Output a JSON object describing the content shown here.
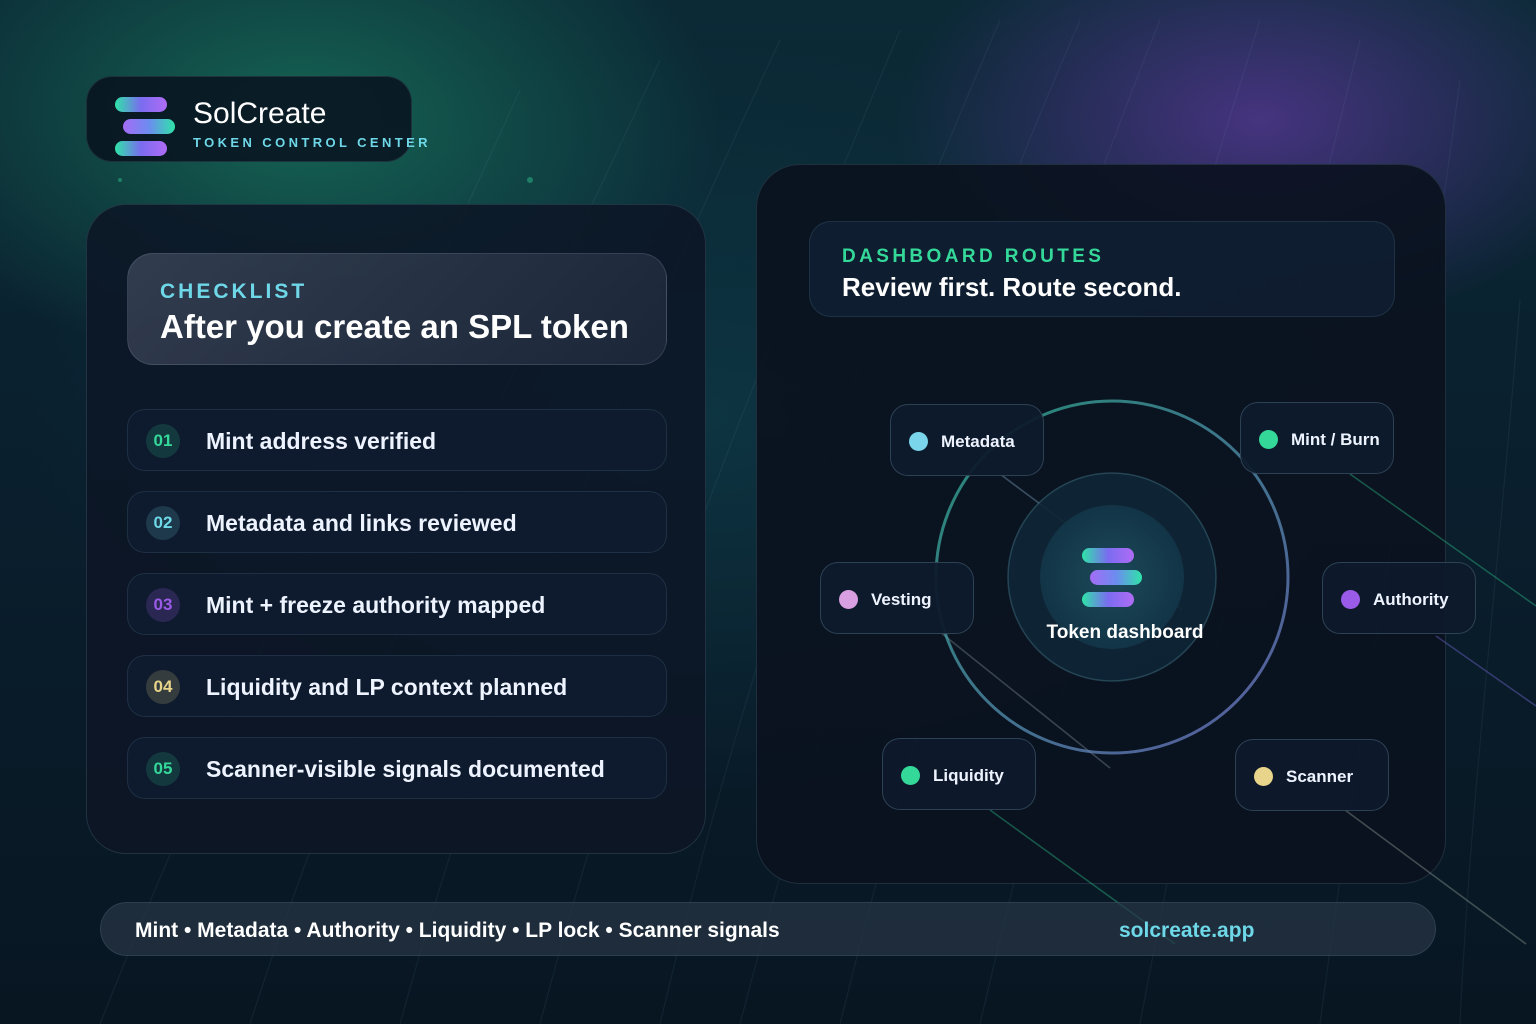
{
  "brand": {
    "name": "SolCreate",
    "subtitle": "TOKEN CONTROL CENTER",
    "icon": "stacked-bars-logo-icon"
  },
  "checklist": {
    "kicker": "CHECKLIST",
    "title": "After you create an SPL token",
    "items": [
      {
        "num": "01",
        "label": "Mint address verified",
        "color": "#34d99a"
      },
      {
        "num": "02",
        "label": "Metadata and links reviewed",
        "color": "#6ed8e8"
      },
      {
        "num": "03",
        "label": "Mint + freeze authority mapped",
        "color": "#9a5ce8"
      },
      {
        "num": "04",
        "label": "Liquidity and LP context planned",
        "color": "#e8d48a"
      },
      {
        "num": "05",
        "label": "Scanner-visible signals documented",
        "color": "#34d99a"
      }
    ]
  },
  "routes": {
    "kicker": "DASHBOARD ROUTES",
    "title": "Review first. Route second.",
    "hub_label": "Token dashboard",
    "nodes": [
      {
        "label": "Metadata",
        "color": "#7ad4ea"
      },
      {
        "label": "Mint / Burn",
        "color": "#34d99a"
      },
      {
        "label": "Vesting",
        "color": "#d8a0e0"
      },
      {
        "label": "Authority",
        "color": "#9a5ce8"
      },
      {
        "label": "Liquidity",
        "color": "#34d99a"
      },
      {
        "label": "Scanner",
        "color": "#e8d48a"
      }
    ]
  },
  "footer": {
    "tags": "Mint • Metadata • Authority • Liquidity • LP lock • Scanner signals",
    "url": "solcreate.app"
  },
  "colors": {
    "accent_cyan": "#6ed8e8",
    "accent_green": "#34d99a",
    "accent_purple": "#9a5ce8"
  }
}
